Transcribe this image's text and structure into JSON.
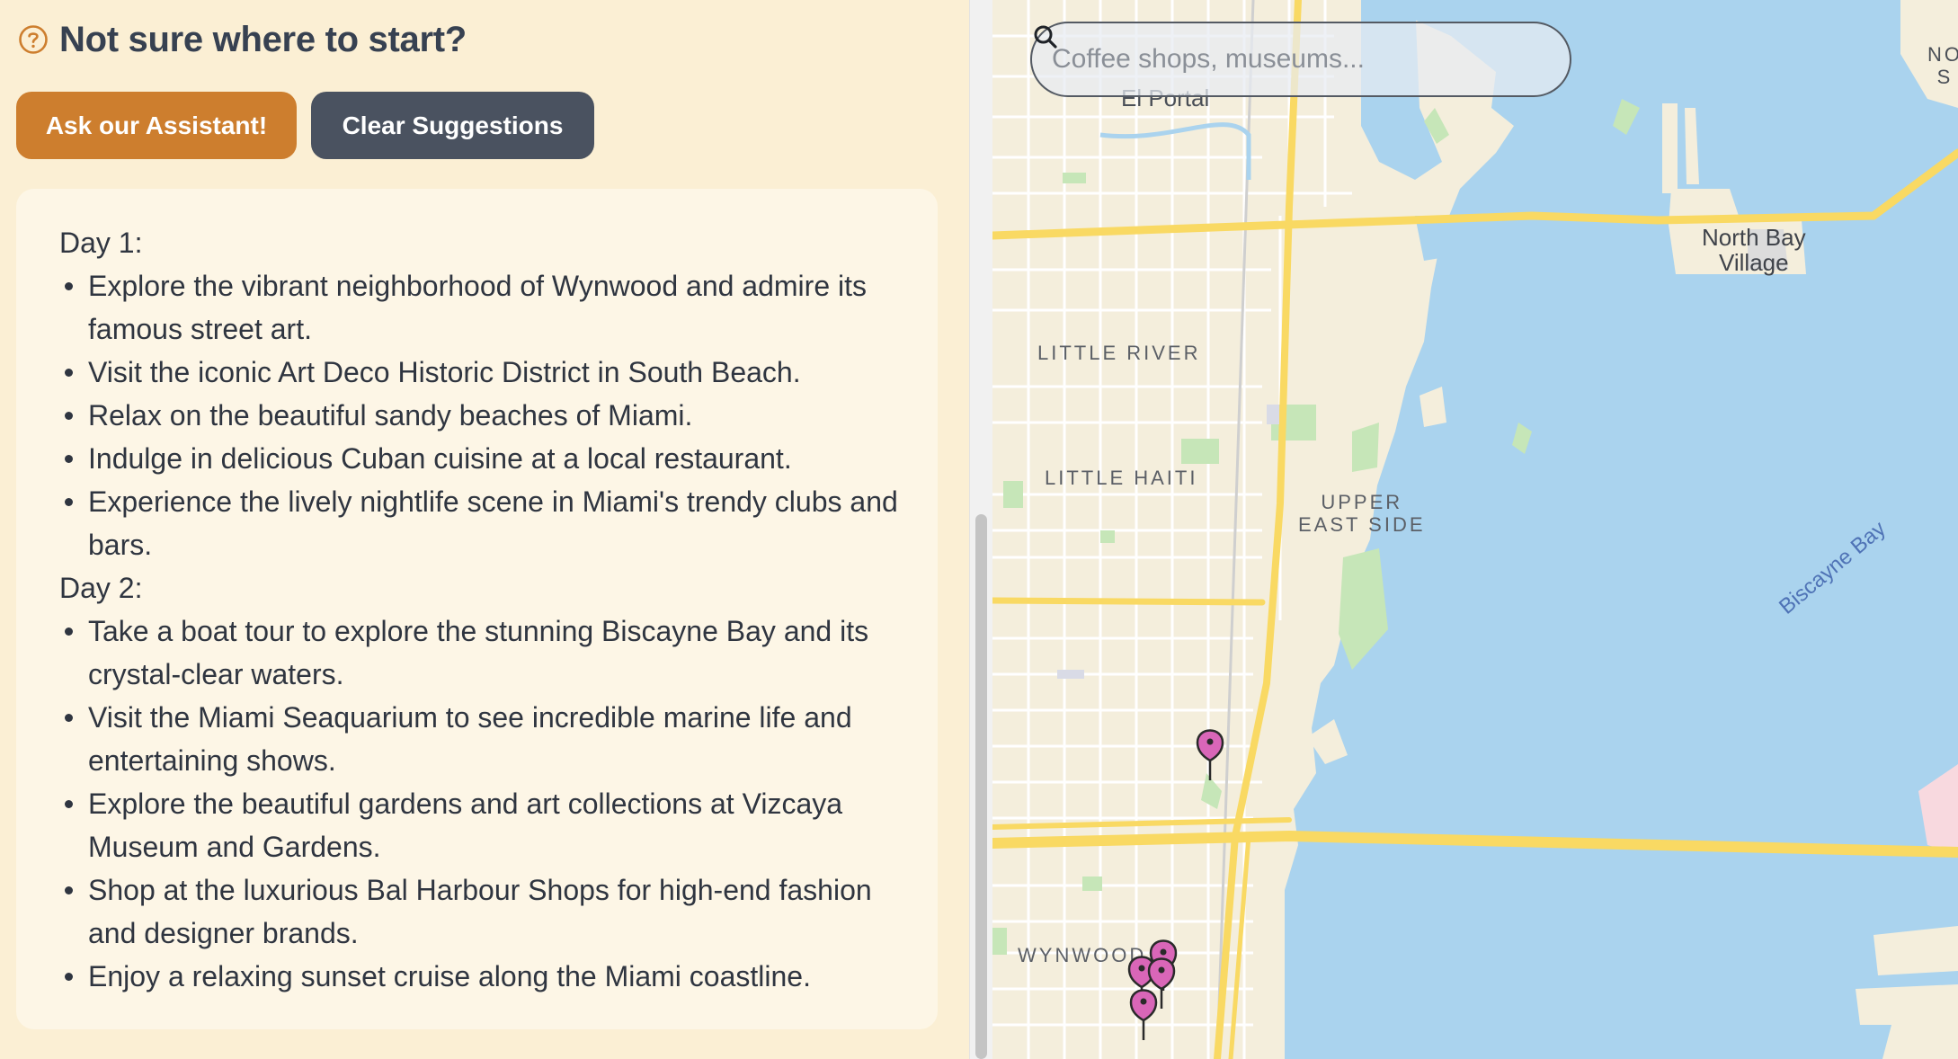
{
  "panel": {
    "heading": "Not sure where to start?",
    "ask_button": "Ask our Assistant!",
    "clear_button": "Clear Suggestions"
  },
  "suggestions": {
    "days": [
      {
        "label": "Day 1:",
        "items": [
          "Explore the vibrant neighborhood of Wynwood and admire its famous street art.",
          "Visit the iconic Art Deco Historic District in South Beach.",
          "Relax on the beautiful sandy beaches of Miami.",
          "Indulge in delicious Cuban cuisine at a local restaurant.",
          "Experience the lively nightlife scene in Miami's trendy clubs and bars."
        ]
      },
      {
        "label": "Day 2:",
        "items": [
          "Take a boat tour to explore the stunning Biscayne Bay and its crystal-clear waters.",
          "Visit the Miami Seaquarium to see incredible marine life and entertaining shows.",
          "Explore the beautiful gardens and art collections at Vizcaya Museum and Gardens.",
          "Shop at the luxurious Bal Harbour Shops for high-end fashion and designer brands.",
          "Enjoy a relaxing sunset cruise along the Miami coastline."
        ]
      }
    ]
  },
  "map": {
    "search_placeholder": "Coffee shops, museums...",
    "labels": {
      "el_portal": "El Portal",
      "little_river": "LITTLE RIVER",
      "little_haiti": "LITTLE HAITI",
      "upper_east_side": "UPPER\nEAST SIDE",
      "north_bay_village": "North Bay\nVillage",
      "biscayne_bay": "Biscayne Bay",
      "wynwood": "WYNWOOD",
      "north_edge": "NO\nS"
    },
    "marker_count": 5,
    "colors": {
      "water": "#aad3ee",
      "land": "#f4eedc",
      "highway": "#f9d963",
      "park": "#c6e6b8",
      "marker": "#d966b8"
    }
  }
}
